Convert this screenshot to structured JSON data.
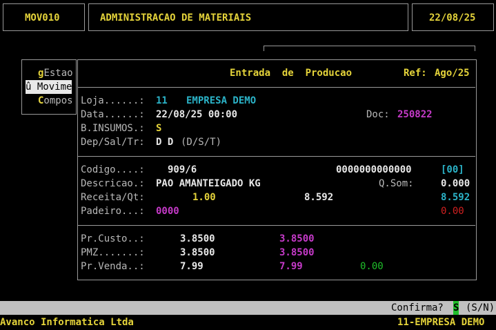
{
  "header": {
    "code": "MOV010",
    "title": "ADMINISTRACAO DE MATERIAIS",
    "date": "22/08/25"
  },
  "menu": {
    "items": [
      {
        "label": "gEstao"
      },
      {
        "label": "û Movime"
      },
      {
        "label": "Compos"
      }
    ]
  },
  "form": {
    "title": "Entrada  de  Producao",
    "ref_label": "Ref:",
    "ref_value": "Ago/25",
    "loja_label": "Loja......:",
    "loja_code": "11",
    "loja_name": "EMPRESA DEMO",
    "data_label": "Data......:",
    "data_value": "22/08/25 00:00",
    "doc_label": "Doc:",
    "doc_value": "250822",
    "binsumos_label": "B.INSUMOS.:",
    "binsumos_value": "S",
    "dep_label": "Dep/Sal/Tr:",
    "dep_value": "D D",
    "dep_hint": "(D/S/T)",
    "codigo_label": "Codigo....:",
    "codigo_value": "909/6",
    "codigo_barcode": "0000000000000",
    "codigo_bracket": "[00]",
    "descricao_label": "Descricao.:",
    "descricao_value": "PAO AMANTEIGADO KG",
    "qsom_label": "Q.Som:",
    "qsom_value": "0.000",
    "receita_label": "Receita/Qt:",
    "receita_value": "1.00",
    "receita_qty": "8.592",
    "receita_qty2": "8.592",
    "padeiro_label": "Padeiro...:",
    "padeiro_value": "0000",
    "padeiro_value2": "0.00",
    "prcusto_label": "Pr.Custo..:",
    "prcusto_value": "3.8500",
    "prcusto_value2": "3.8500",
    "pmz_label": "PMZ.......:",
    "pmz_value": "3.8500",
    "pmz_value2": "3.8500",
    "prvenda_label": "Pr.Venda..:",
    "prvenda_value": "7.99",
    "prvenda_value2": "7.99",
    "prvenda_value3": "0.00"
  },
  "status": {
    "prompt": "Confirma?",
    "answer": "S",
    "options": "(S/N)"
  },
  "footer": {
    "company": "Avanco Informatica Ltda",
    "empresa": "11-EMPRESA DEMO"
  }
}
